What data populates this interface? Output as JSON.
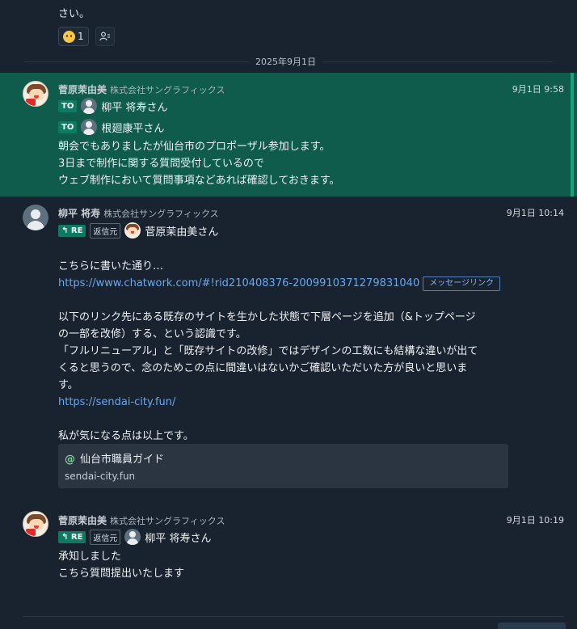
{
  "previous": {
    "tail_text": "さい。",
    "reaction_count": "1"
  },
  "date_divider": "2025年9月1日",
  "messages": [
    {
      "sender": "菅原茉由美",
      "org": "株式会社サングラフィックス",
      "time": "9月1日 9:58",
      "to": [
        {
          "tag": "TO",
          "name": "柳平 将寿さん"
        },
        {
          "tag": "TO",
          "name": "根廻康平さん"
        }
      ],
      "lines": [
        "朝会でもありましたが仙台市のプロポーザル参加します。",
        "3日まで制作に関する質問受付しているので",
        "ウェブ制作において質問事項などあれば確認しておきます。"
      ]
    },
    {
      "sender": "柳平 将寿",
      "org": "株式会社サングラフィックス",
      "time": "9月1日 10:14",
      "reply_tag": "RE",
      "reply_sub": "返信元",
      "reply_name": "菅原茉由美さん",
      "intro": "こちらに書いた通り…",
      "link_url": "https://www.chatwork.com/#!rid210408376-2009910371279831040",
      "link_badge": "メッセージリンク",
      "para1_line1": "以下のリンク先にある既存のサイトを生かした状態で下層ページを追加（&トップページ",
      "para1_line2": "の一部を改修）する、という認識です。",
      "para2_line1": "「フルリニューアル」と「既存サイトの改修」ではデザインの工数にも結構な違いが出て",
      "para2_line2": "くると思うので、念のためこの点に間違いはないかご確認いただいた方が良いと思いま",
      "para2_line3": "す。",
      "site_url": "https://sendai-city.fun/",
      "closing": "私が気になる点は以上です。",
      "preview_at": "@",
      "preview_title": "仙台市職員ガイド",
      "preview_url": "sendai-city.fun"
    },
    {
      "sender": "菅原茉由美",
      "org": "株式会社サングラフィックス",
      "time": "9月1日 10:19",
      "reply_tag": "RE",
      "reply_sub": "返信元",
      "reply_name": "柳平 将寿さん",
      "lines": [
        "承知しました",
        "こちら質問提出いたします"
      ]
    }
  ],
  "colors": {
    "highlight": "#0f5b4c",
    "accent": "#17a37e",
    "link": "#6aa6f0",
    "background": "#192330"
  }
}
